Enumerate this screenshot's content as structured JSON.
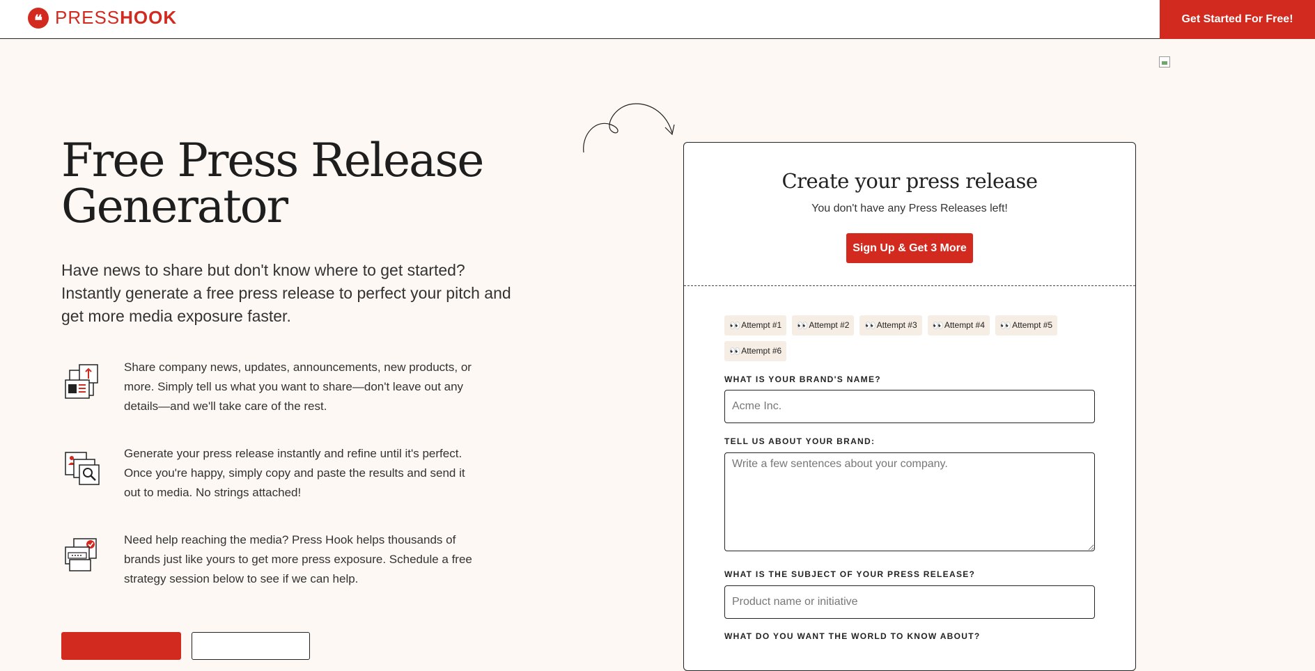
{
  "header": {
    "logo_mark": "❝",
    "logo_text_light": "PRESS",
    "logo_text_bold": "HOOK",
    "cta": "Get Started For Free!"
  },
  "hero": {
    "title_line1": "Free Press Release",
    "title_line2": "Generator",
    "intro": "Have news to share but don't know where to get started? Instantly generate a free press release to perfect your pitch and get more media exposure faster."
  },
  "features": [
    {
      "icon": "share-news-icon",
      "text": "Share company news, updates, announcements, new products, or more. Simply tell us what you want to share—don't leave out any details—and we'll take care of the rest."
    },
    {
      "icon": "generate-search-icon",
      "text": "Generate your press release instantly and refine until it's perfect. Once you're happy, simply copy and paste the results and send it out to media. No strings attached!"
    },
    {
      "icon": "media-help-icon",
      "text": "Need help reaching the media? Press Hook helps thousands of brands just like yours to get more press exposure. Schedule a free strategy session below to see if we can help."
    }
  ],
  "card": {
    "title": "Create your press release",
    "subtitle": "You don't have any Press Releases left!",
    "signup_button": "Sign Up & Get 3 More",
    "attempt_eyes": "👀",
    "attempts": [
      "Attempt #1",
      "Attempt #2",
      "Attempt #3",
      "Attempt #4",
      "Attempt #5",
      "Attempt #6"
    ],
    "form": {
      "brand_name_label": "WHAT IS YOUR BRAND'S NAME?",
      "brand_name_placeholder": "Acme Inc.",
      "brand_name_value": "",
      "about_label": "TELL US ABOUT YOUR BRAND:",
      "about_placeholder": "Write a few sentences about your company.",
      "about_value": "",
      "subject_label": "WHAT IS THE SUBJECT OF YOUR PRESS RELEASE?",
      "subject_placeholder": "Product name or initiative",
      "subject_value": "",
      "world_label": "WHAT DO YOU WANT THE WORLD TO KNOW ABOUT?"
    }
  },
  "colors": {
    "accent": "#d22a1f",
    "background": "#fdf8f3",
    "chip": "#f6ede4"
  }
}
